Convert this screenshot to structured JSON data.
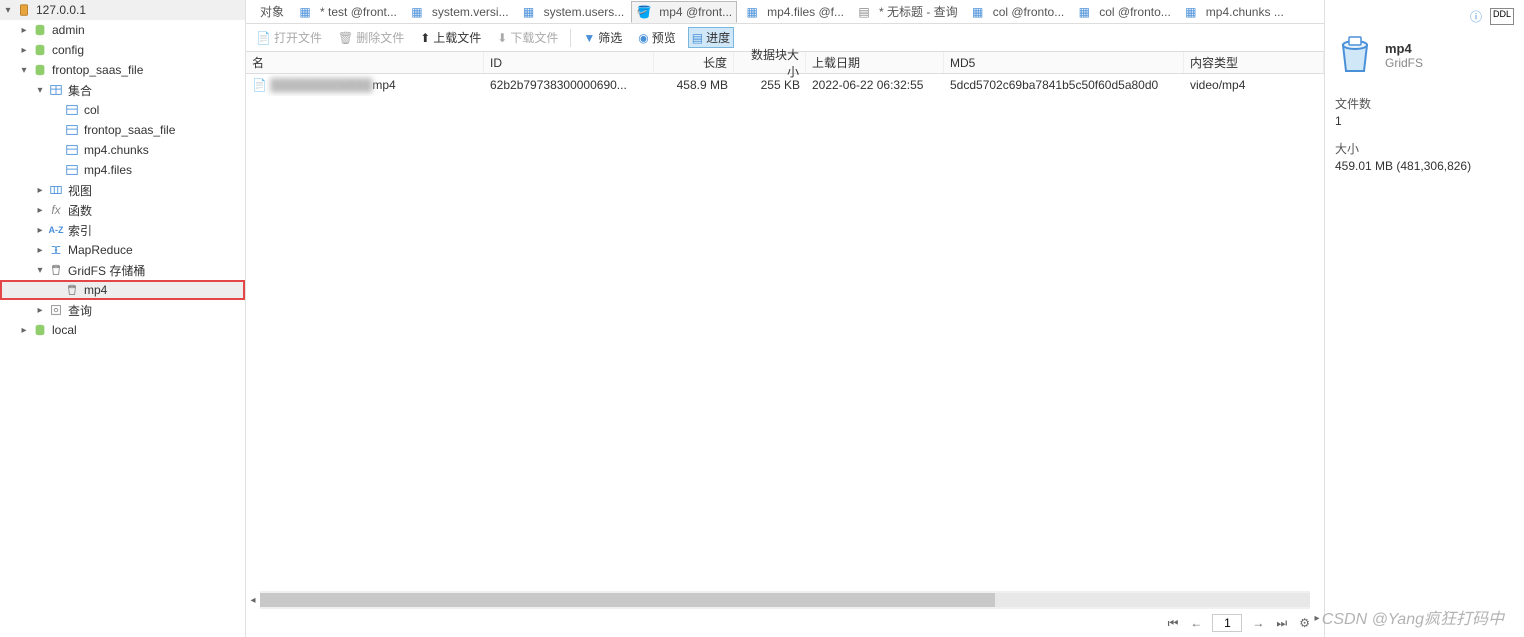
{
  "sidebar": {
    "root": "127.0.0.1",
    "databases": [
      {
        "name": "admin",
        "expanded": false
      },
      {
        "name": "config",
        "expanded": false
      },
      {
        "name": "frontop_saas_file",
        "expanded": true,
        "sections": {
          "collections": {
            "label": "集合",
            "items": [
              "col",
              "frontop_saas_file",
              "mp4.chunks",
              "mp4.files"
            ]
          },
          "views": "视图",
          "functions": "函数",
          "indexes": "索引",
          "mapreduce": "MapReduce",
          "gridfs": {
            "label": "GridFS 存储桶",
            "items": [
              "mp4"
            ]
          },
          "queries": "查询"
        }
      },
      {
        "name": "local",
        "expanded": false
      }
    ]
  },
  "tabs": {
    "leading": "对象",
    "items": [
      {
        "label": "* test @front...",
        "icon": "table"
      },
      {
        "label": "system.versi...",
        "icon": "table"
      },
      {
        "label": "system.users...",
        "icon": "table"
      },
      {
        "label": "mp4 @front...",
        "icon": "bucket",
        "active": true
      },
      {
        "label": "mp4.files @f...",
        "icon": "table"
      },
      {
        "label": "* 无标题 - 查询",
        "icon": "query"
      },
      {
        "label": "col @fronto...",
        "icon": "table"
      },
      {
        "label": "col @fronto...",
        "icon": "table"
      },
      {
        "label": "mp4.chunks ...",
        "icon": "table"
      }
    ]
  },
  "toolbar": {
    "open_file": "打开文件",
    "delete_file": "删除文件",
    "upload_file": "上载文件",
    "download_file": "下载文件",
    "filter": "筛选",
    "preview": "预览",
    "progress": "进度"
  },
  "table": {
    "headers": {
      "name": "名",
      "id": "ID",
      "length": "长度",
      "chunk_size": "数据块大小",
      "upload_date": "上载日期",
      "md5": "MD5",
      "content_type": "内容类型"
    },
    "rows": [
      {
        "name_suffix": "mp4",
        "id": "62b2b79738300000690...",
        "length": "458.9 MB",
        "chunk_size": "255 KB",
        "upload_date": "2022-06-22 06:32:55",
        "md5": "5dcd5702c69ba7841b5c50f60d5a80d0",
        "content_type": "video/mp4"
      }
    ]
  },
  "pagination": {
    "page": "1"
  },
  "right_panel": {
    "title": "mp4",
    "subtitle": "GridFS",
    "stats": [
      {
        "label": "文件数",
        "value": "1"
      },
      {
        "label": "大小",
        "value": "459.01 MB (481,306,826)"
      }
    ]
  },
  "watermark": "CSDN @Yang疯狂打码中"
}
